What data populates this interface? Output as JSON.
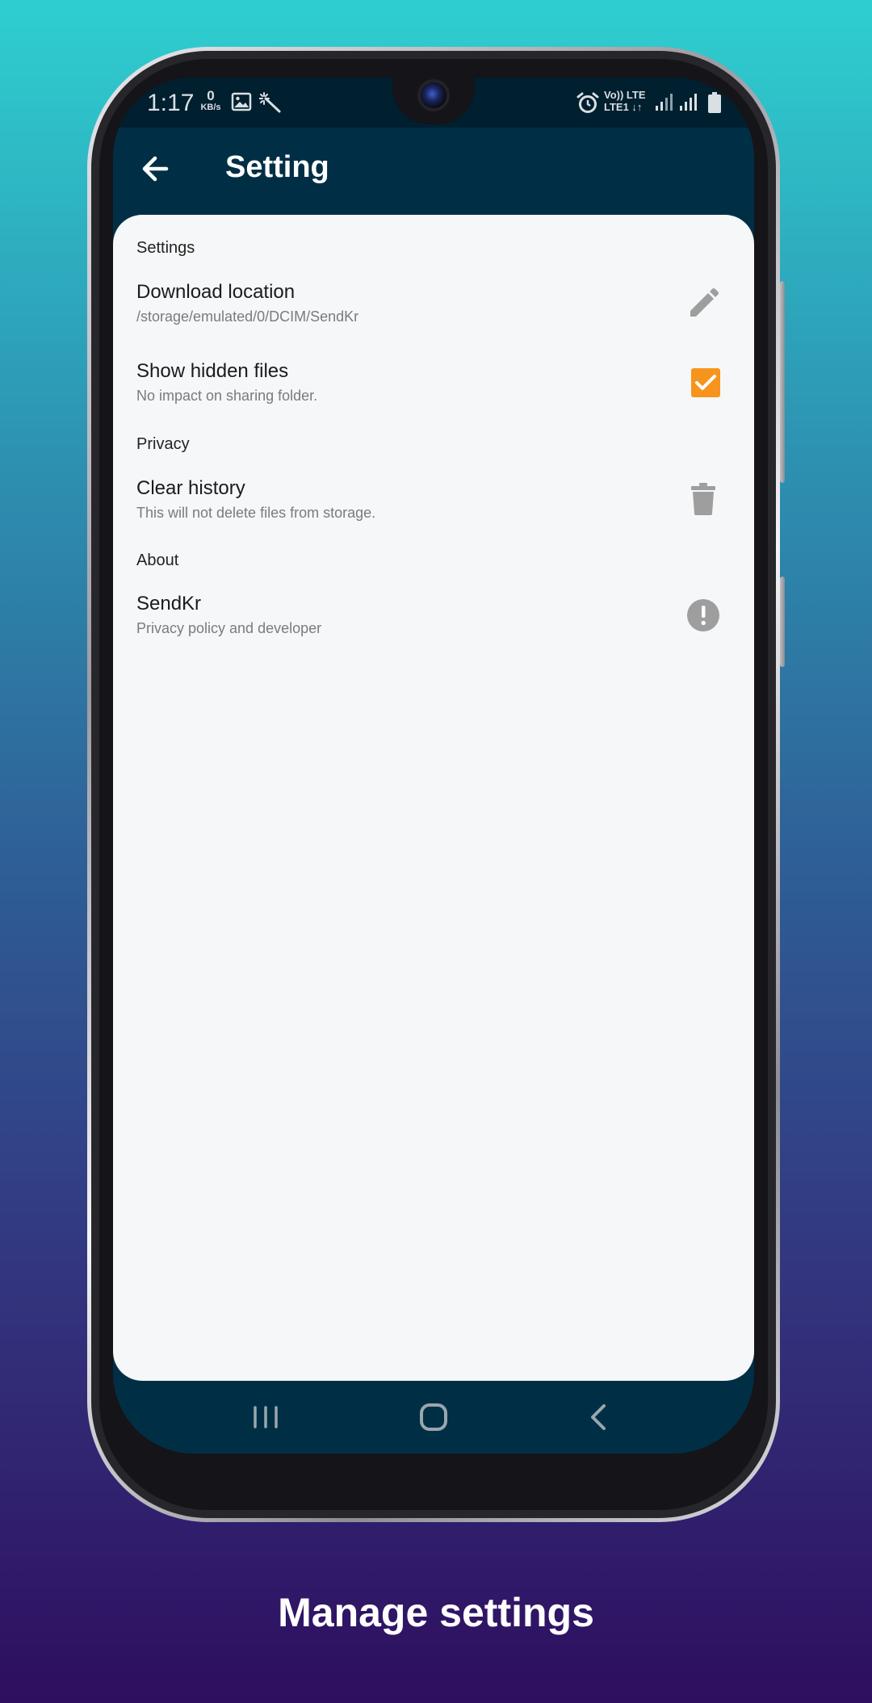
{
  "status_bar": {
    "time": "1:17",
    "net_speed_value": "0",
    "net_speed_unit": "KB/s",
    "volte_line1": "Vo))  LTE",
    "volte_line2": "LTE1 ↓↑",
    "icons": [
      "image-icon",
      "magic-wand-icon",
      "alarm-icon",
      "signal-icon",
      "signal-icon",
      "battery-icon"
    ]
  },
  "app_bar": {
    "title": "Setting",
    "back_icon": "arrow-back-icon"
  },
  "sections": {
    "settings": {
      "title": "Settings",
      "download_location": {
        "title": "Download location",
        "subtitle": "/storage/emulated/0/DCIM/SendKr",
        "icon": "pencil-icon"
      },
      "show_hidden": {
        "title": "Show hidden files",
        "subtitle": "No impact on sharing folder.",
        "checked": true
      }
    },
    "privacy": {
      "title": "Privacy",
      "clear_history": {
        "title": "Clear history",
        "subtitle": "This will not delete files from storage.",
        "icon": "trash-icon"
      }
    },
    "about": {
      "title": "About",
      "app": {
        "title": "SendKr",
        "subtitle": "Privacy policy and developer",
        "icon": "info-alert-icon"
      }
    }
  },
  "nav_bar": {
    "icons": [
      "recents-icon",
      "home-icon",
      "back-icon"
    ]
  },
  "caption": "Manage settings",
  "colors": {
    "app_bar": "#002f45",
    "status_bar": "#001f2f",
    "content_bg": "#f5f7f8",
    "checkbox": "#f7941d",
    "icon_grey": "#9e9e9e"
  }
}
